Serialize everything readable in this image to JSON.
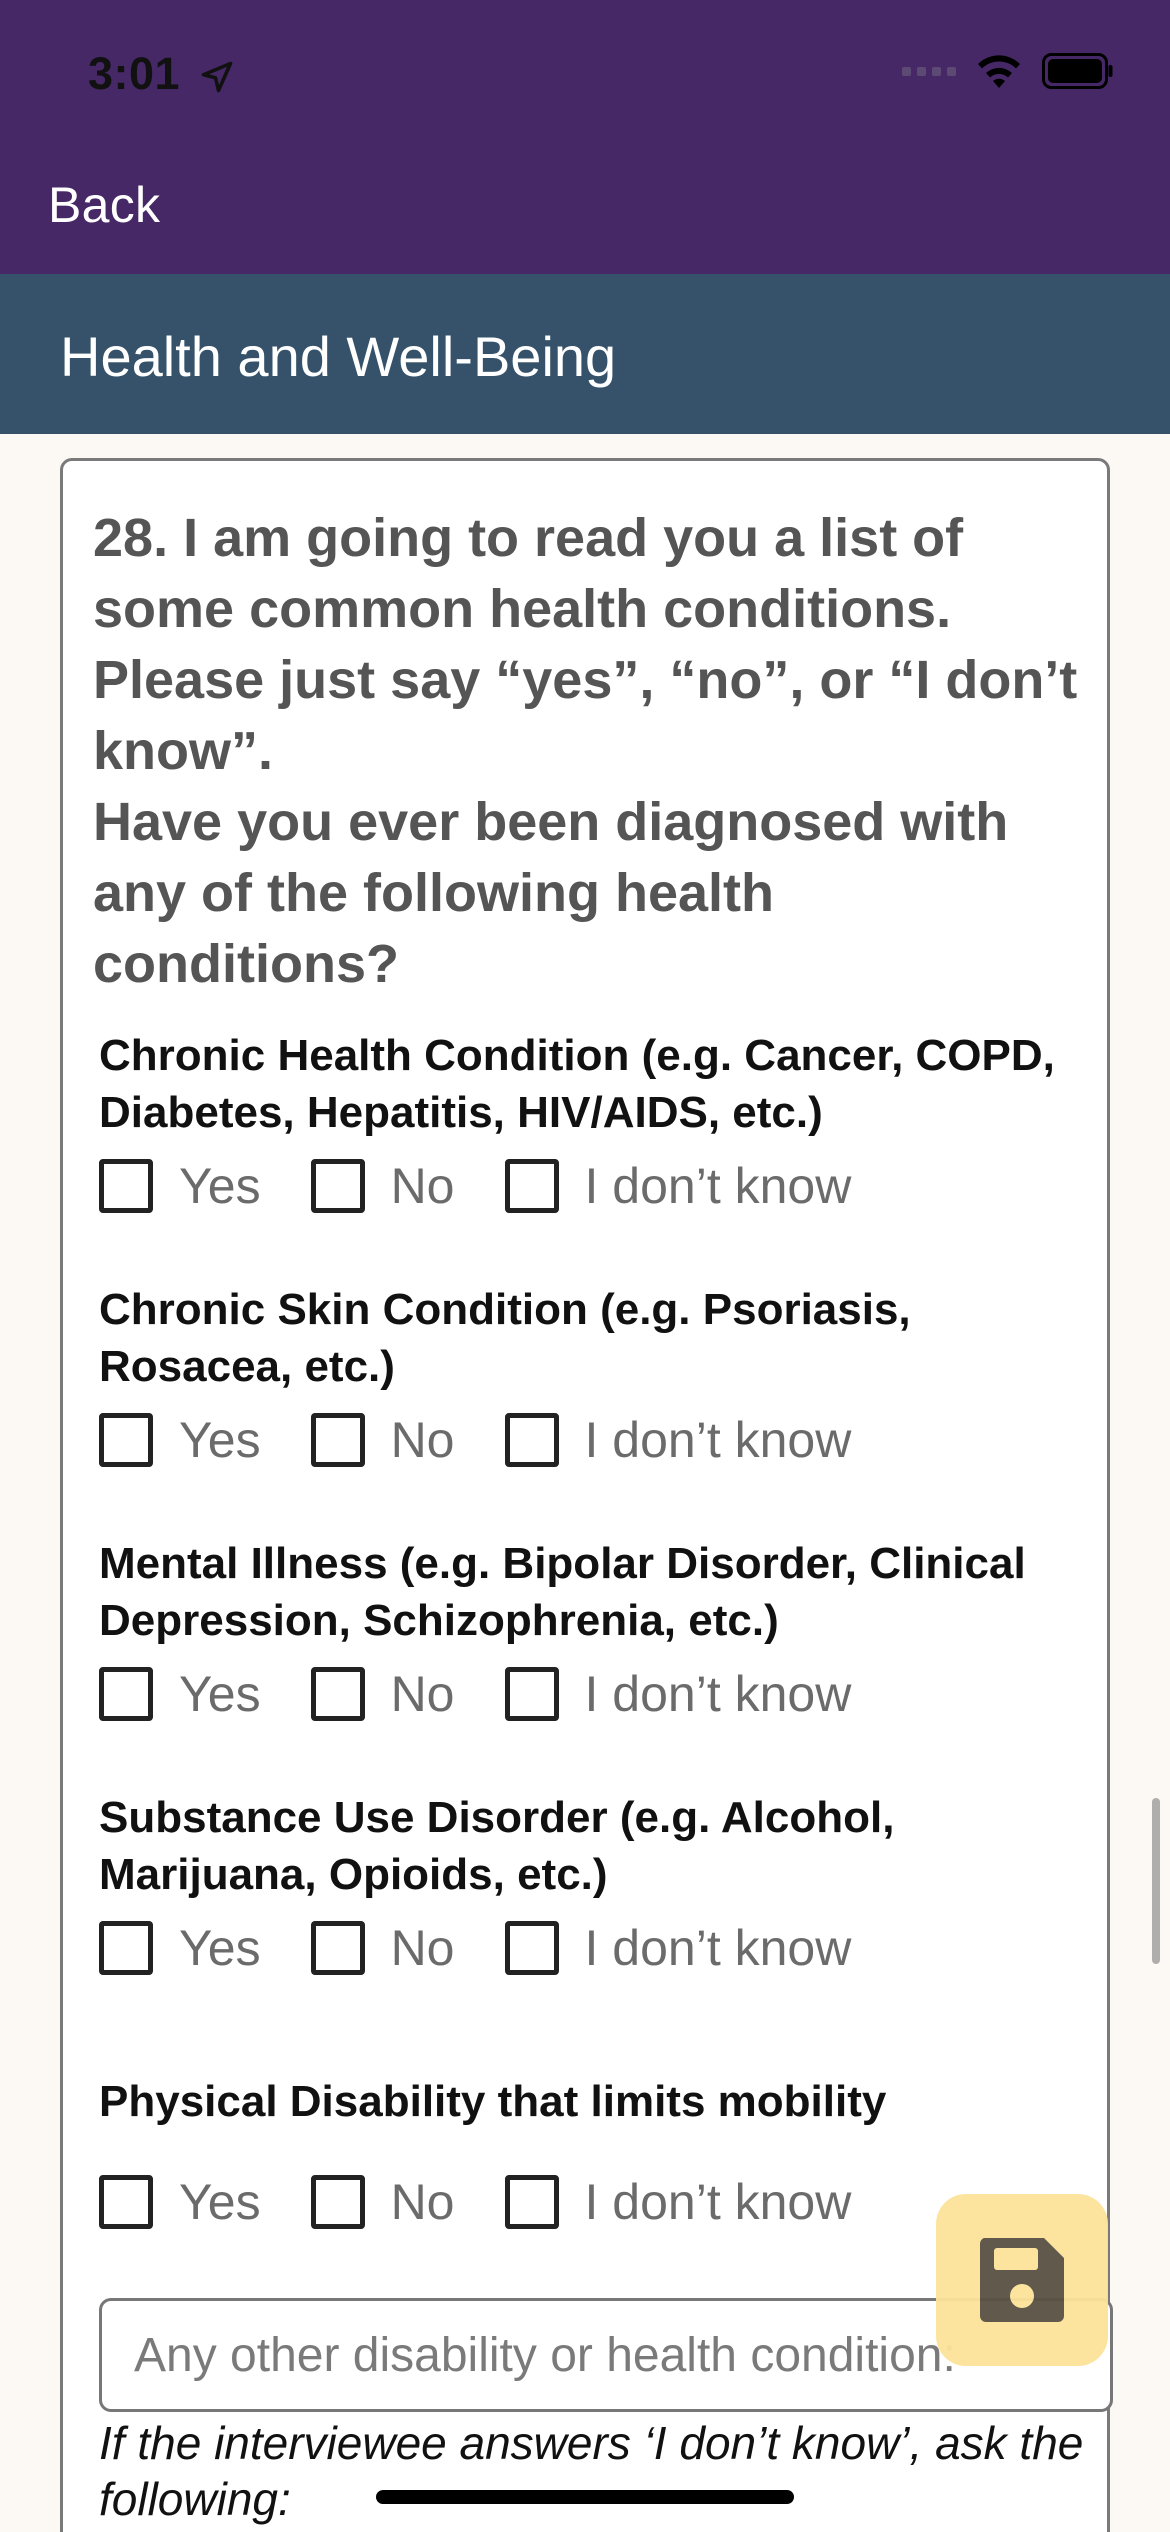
{
  "status_bar": {
    "time": "3:01"
  },
  "nav": {
    "back_label": "Back"
  },
  "header": {
    "title": "Health and Well-Being"
  },
  "question": {
    "line1": "28. I am going to read you a list of some common health conditions. Please just say “yes”, “no”, or “I don’t know”.",
    "line2": "Have you ever been diagnosed with any of the following health conditions?"
  },
  "options": {
    "yes": "Yes",
    "no": "No",
    "dont_know": "I don’t know"
  },
  "conditions": [
    {
      "label": "Chronic Health Condition (e.g. Cancer, COPD, Diabetes, Hepatitis, HIV/AIDS, etc.)"
    },
    {
      "label": "Chronic Skin Condition (e.g. Psoriasis, Rosacea, etc.)"
    },
    {
      "label": "Mental Illness (e.g. Bipolar Disorder, Clinical Depression, Schizophrenia, etc.)"
    },
    {
      "label": "Substance Use Disorder (e.g. Alcohol, Marijuana, Opioids, etc.)"
    },
    {
      "label": "Physical Disability that limits mobility"
    }
  ],
  "other": {
    "placeholder": "Any other disability or health condition:"
  },
  "note": "If the interviewee answers ‘I don’t know’, ask the following:",
  "icons": {
    "save": "floppy-disk-icon",
    "location": "location-arrow-icon",
    "wifi": "wifi-icon",
    "battery": "battery-icon"
  },
  "colors": {
    "nav": "#472866",
    "header": "#35526a",
    "save_button": "#fce39a",
    "background": "#fcf8f3"
  }
}
